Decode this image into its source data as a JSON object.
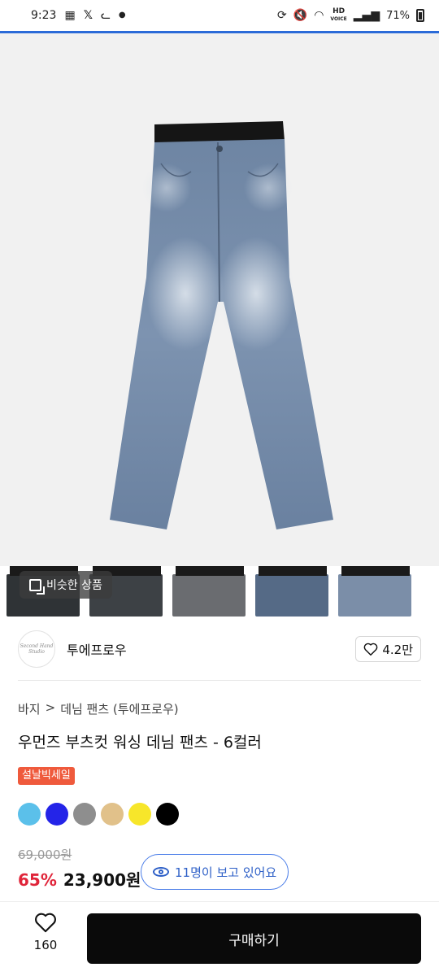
{
  "status_bar": {
    "time": "9:23",
    "battery": "71%",
    "hd_label_top": "HD",
    "hd_label_bottom": "VOICE"
  },
  "similar_button": {
    "label": "비슷한 상품"
  },
  "shop": {
    "logo_text": "Second Hand Studio",
    "name": "투에프로우",
    "likes": "4.2만"
  },
  "breadcrumb": {
    "parent": "바지",
    "separator": ">",
    "current": "데님 팬츠 (투에프로우)"
  },
  "product": {
    "title": "우먼즈 부츠컷 워싱 데님 팬츠 - 6컬러",
    "badge": "설날빅세일",
    "color_options": [
      "#5bc0ea",
      "#2424e8",
      "#8e8e8e",
      "#e1c18a",
      "#f7e62a",
      "#000000"
    ],
    "original_price": "69,000원",
    "discount": "65%",
    "price": "23,900원"
  },
  "viewers": {
    "label": "11명이 보고 있어요"
  },
  "bottom": {
    "wish_count": "160",
    "buy_label": "구매하기"
  },
  "colors": {
    "accent": "#2b6bd8",
    "discount": "#e0253a",
    "badge": "#ef5a3c"
  }
}
